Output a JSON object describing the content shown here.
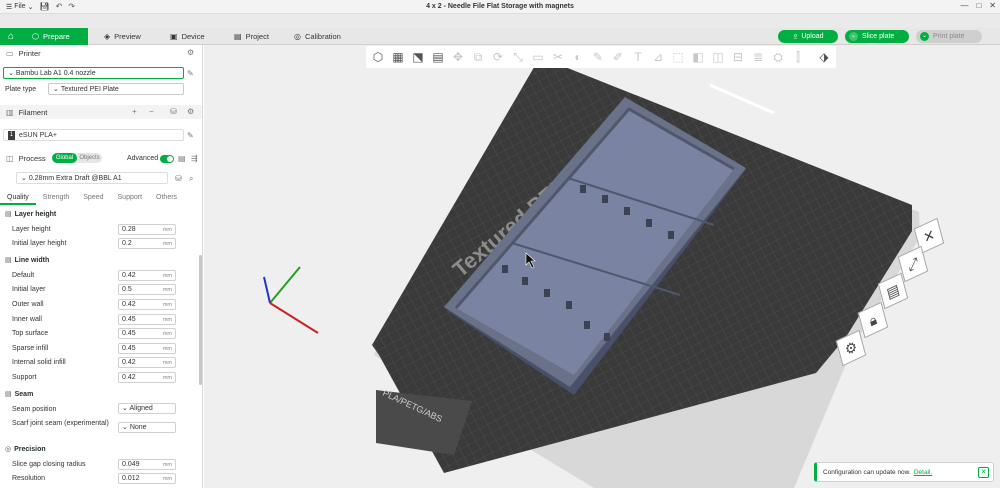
{
  "window": {
    "title": "4 x 2 - Needle File Flat Storage with magnets",
    "menu_file": "File",
    "controls": [
      "—",
      "□",
      "✕"
    ]
  },
  "topbar": {
    "tabs": [
      {
        "label": "Prepare",
        "icon": "cube-icon"
      },
      {
        "label": "Preview",
        "icon": "layers-icon"
      },
      {
        "label": "Device",
        "icon": "device-icon"
      },
      {
        "label": "Project",
        "icon": "project-icon"
      },
      {
        "label": "Calibration",
        "icon": "calibration-icon"
      }
    ],
    "upload": "Upload",
    "slice_plate": "Slice plate",
    "print_plate": "Print plate"
  },
  "printer": {
    "header": "Printer",
    "name": "Bambu Lab A1 0.4 nozzle",
    "plate_type_label": "Plate type",
    "plate_type": "Textured PEI Plate"
  },
  "filament": {
    "header": "Filament",
    "index": "1",
    "name": "eSUN PLA+",
    "add": "+",
    "remove": "−"
  },
  "process": {
    "header": "Process",
    "global": "Global",
    "objects": "Objects",
    "advanced": "Advanced",
    "preset": "0.28mm Extra Draft @BBL A1",
    "tabs": [
      "Quality",
      "Strength",
      "Speed",
      "Support",
      "Others"
    ],
    "groups": [
      {
        "title": "Layer height",
        "rows": [
          {
            "label": "Layer height",
            "value": "0.28",
            "unit": "mm"
          },
          {
            "label": "Initial layer height",
            "value": "0.2",
            "unit": "mm"
          }
        ]
      },
      {
        "title": "Line width",
        "rows": [
          {
            "label": "Default",
            "value": "0.42",
            "unit": "mm"
          },
          {
            "label": "Initial layer",
            "value": "0.5",
            "unit": "mm"
          },
          {
            "label": "Outer wall",
            "value": "0.42",
            "unit": "mm"
          },
          {
            "label": "Inner wall",
            "value": "0.45",
            "unit": "mm"
          },
          {
            "label": "Top surface",
            "value": "0.45",
            "unit": "mm"
          },
          {
            "label": "Sparse infill",
            "value": "0.45",
            "unit": "mm"
          },
          {
            "label": "Internal solid infill",
            "value": "0.42",
            "unit": "mm"
          },
          {
            "label": "Support",
            "value": "0.42",
            "unit": "mm"
          }
        ]
      },
      {
        "title": "Seam",
        "rows": [
          {
            "label": "Seam position",
            "value": "Aligned",
            "unit": ""
          },
          {
            "label": "Scarf joint seam (experimental)",
            "value": "None",
            "unit": ""
          }
        ]
      },
      {
        "title": "Precision",
        "rows": [
          {
            "label": "Slice gap closing radius",
            "value": "0.049",
            "unit": "mm"
          },
          {
            "label": "Resolution",
            "value": "0.012",
            "unit": "mm"
          }
        ]
      }
    ]
  },
  "viewport": {
    "plate_text": "Textured PEI plate",
    "plate_label": "PLA/PETG/ABS"
  },
  "notification": {
    "text": "Configuration can update now.",
    "link": "Detail."
  },
  "colors": {
    "accent": "#00ae42",
    "plate": "#3a3a3a",
    "model": "#6a7289"
  }
}
